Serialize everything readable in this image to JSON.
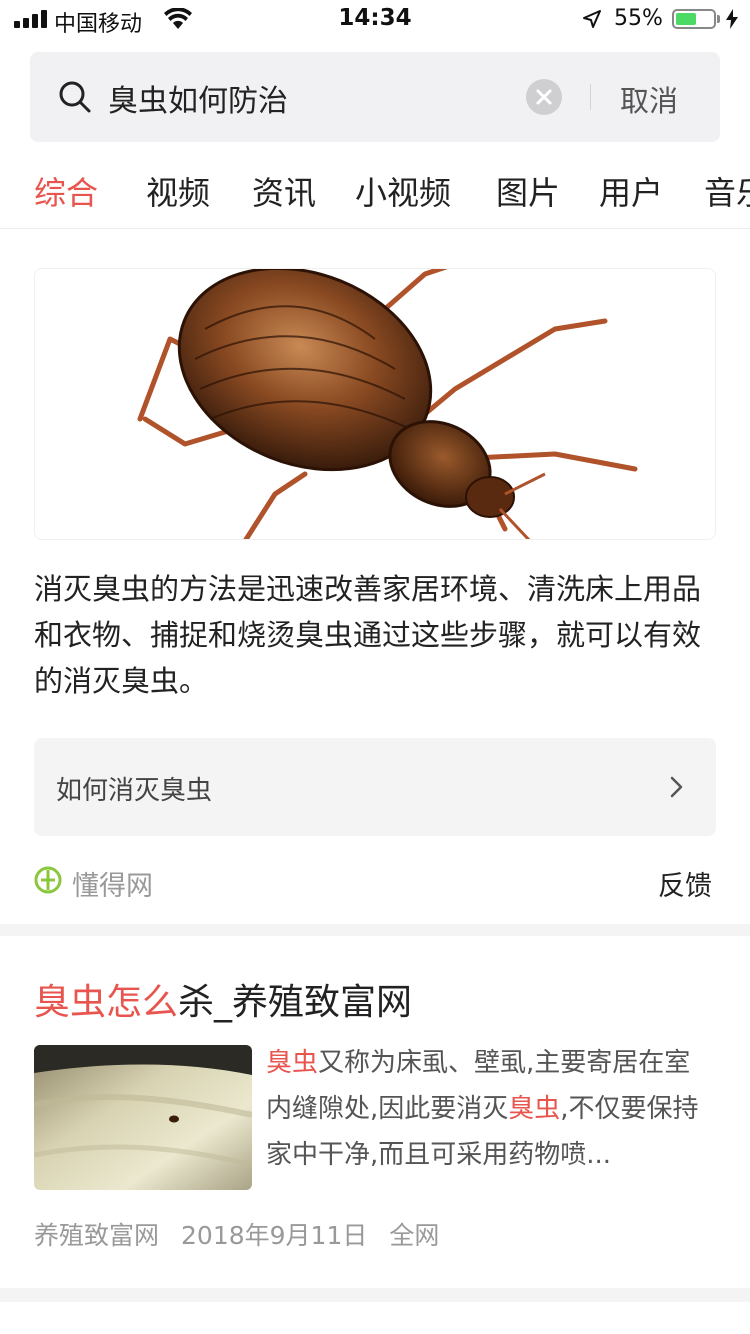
{
  "status_bar": {
    "carrier": "中国移动",
    "time": "14:34",
    "battery_pct": "55%",
    "battery_level": 0.55,
    "battery_color": "#4cd964"
  },
  "search": {
    "query": "臭虫如何防治",
    "cancel_label": "取消",
    "icons": [
      "search-icon",
      "clear-icon"
    ]
  },
  "tabs": [
    {
      "label": "综合",
      "active": true
    },
    {
      "label": "视频",
      "active": false
    },
    {
      "label": "资讯",
      "active": false
    },
    {
      "label": "小视频",
      "active": false
    },
    {
      "label": "图片",
      "active": false
    },
    {
      "label": "用户",
      "active": false
    },
    {
      "label": "音乐",
      "active": false
    }
  ],
  "answer_card": {
    "text": "消灭臭虫的方法是迅速改善家居环境、清洗床上用品和衣物、捕捉和烧烫臭虫通过这些步骤，就可以有效的消灭臭虫。",
    "related_query": "如何消灭臭虫",
    "source": "懂得网",
    "feedback_label": "反馈"
  },
  "result_2": {
    "title_highlight": "臭虫怎么",
    "title_rest": "杀_养殖致富网",
    "snippet_hl_1": "臭虫",
    "snippet_part_1": "又称为床虱、壁虱,主要寄居在室内缝隙处,因此要消灭",
    "snippet_hl_2": "臭虫",
    "snippet_part_2": ",不仅要保持家中干净,而且可采用药物喷...",
    "source": "养殖致富网",
    "date": "2018年9月11日",
    "scope": "全网"
  },
  "colors": {
    "accent": "#e8554e",
    "search_bg": "#f1f1f3",
    "separator": "#f4f4f4"
  }
}
